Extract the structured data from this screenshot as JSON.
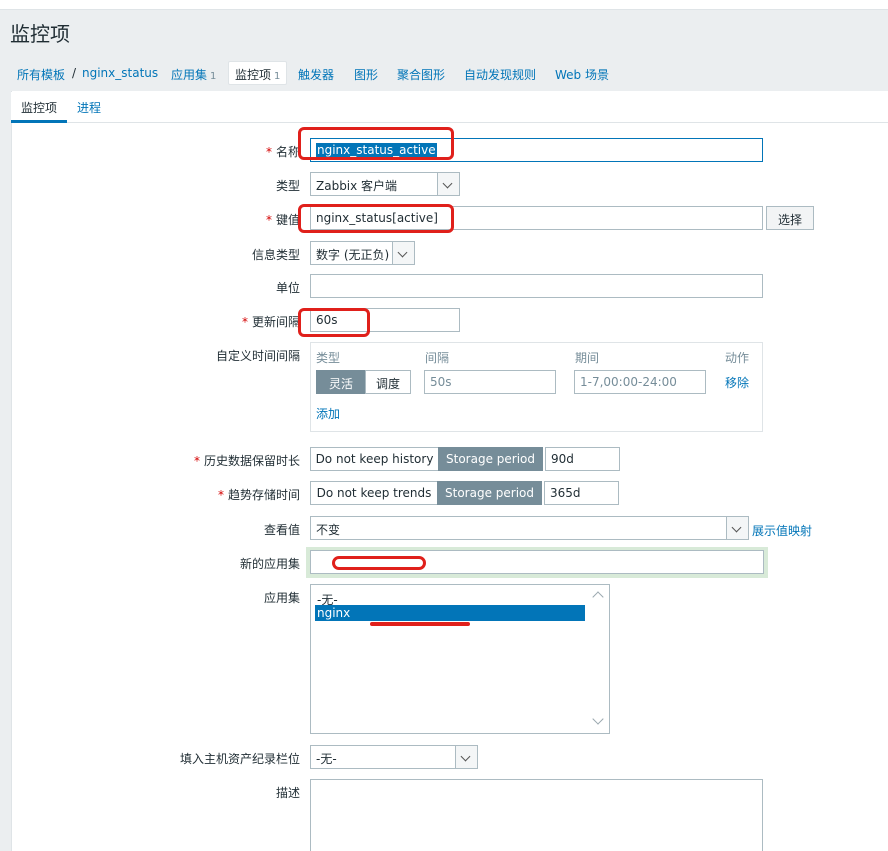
{
  "page": {
    "title": "监控项"
  },
  "breadcrumb": {
    "all_templates": "所有模板",
    "separator": "/",
    "template": "nginx_status",
    "items": [
      {
        "label": "应用集",
        "count": "1"
      },
      {
        "label": "监控项",
        "count": "1"
      },
      {
        "label": "触发器"
      },
      {
        "label": "图形"
      },
      {
        "label": "聚合图形"
      },
      {
        "label": "自动发现规则"
      },
      {
        "label": "Web 场景"
      }
    ]
  },
  "tabs": [
    {
      "label": "监控项"
    },
    {
      "label": "进程"
    }
  ],
  "form": {
    "name": {
      "label": "名称",
      "value": "nginx_status_active"
    },
    "type": {
      "label": "类型",
      "value": "Zabbix 客户端"
    },
    "key": {
      "label": "键值",
      "value": "nginx_status[active]",
      "button": "选择"
    },
    "info_type": {
      "label": "信息类型",
      "value": "数字 (无正负)"
    },
    "units": {
      "label": "单位",
      "value": ""
    },
    "interval": {
      "label": "更新间隔",
      "value": "60s"
    },
    "custom_intervals": {
      "label": "自定义时间间隔",
      "col_type": "类型",
      "col_interval": "间隔",
      "col_period": "期间",
      "col_action": "动作",
      "flexible": "灵活",
      "scheduling": "调度",
      "interval_placeholder": "50s",
      "period_placeholder": "1-7,00:00-24:00",
      "remove": "移除",
      "add": "添加"
    },
    "history": {
      "label": "历史数据保留时长",
      "opt_no": "Do not keep history",
      "opt_period": "Storage period",
      "value": "90d"
    },
    "trends": {
      "label": "趋势存储时间",
      "opt_no": "Do not keep trends",
      "opt_period": "Storage period",
      "value": "365d"
    },
    "valuemap": {
      "label": "查看值",
      "value": "不变",
      "link": "展示值映射"
    },
    "new_application": {
      "label": "新的应用集",
      "value": ""
    },
    "applications": {
      "label": "应用集",
      "options": [
        "-无-",
        "nginx"
      ]
    },
    "inventory": {
      "label": "填入主机资产纪录栏位",
      "value": "-无-"
    },
    "description": {
      "label": "描述",
      "value": ""
    }
  },
  "colors": {
    "accent": "#0275b8",
    "required": "#d40000",
    "annotation": "#e0201b",
    "segment_on": "#768d99"
  }
}
